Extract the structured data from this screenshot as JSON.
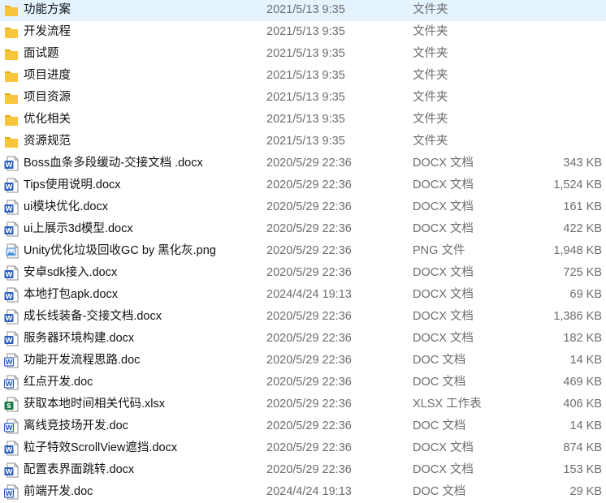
{
  "files": [
    {
      "name": "功能方案",
      "date": "2021/5/13 9:35",
      "type": "文件夹",
      "size": "",
      "icon": "folder-icon"
    },
    {
      "name": "开发流程",
      "date": "2021/5/13 9:35",
      "type": "文件夹",
      "size": "",
      "icon": "folder-icon"
    },
    {
      "name": "面试题",
      "date": "2021/5/13 9:35",
      "type": "文件夹",
      "size": "",
      "icon": "folder-icon"
    },
    {
      "name": "项目进度",
      "date": "2021/5/13 9:35",
      "type": "文件夹",
      "size": "",
      "icon": "folder-icon"
    },
    {
      "name": "项目资源",
      "date": "2021/5/13 9:35",
      "type": "文件夹",
      "size": "",
      "icon": "folder-icon"
    },
    {
      "name": "优化相关",
      "date": "2021/5/13 9:35",
      "type": "文件夹",
      "size": "",
      "icon": "folder-icon"
    },
    {
      "name": "资源规范",
      "date": "2021/5/13 9:35",
      "type": "文件夹",
      "size": "",
      "icon": "folder-icon"
    },
    {
      "name": "Boss血条多段缓动-交接文档 .docx",
      "date": "2020/5/29 22:36",
      "type": "DOCX 文档",
      "size": "343 KB",
      "icon": "word-docx-icon"
    },
    {
      "name": "Tips使用说明.docx",
      "date": "2020/5/29 22:36",
      "type": "DOCX 文档",
      "size": "1,524 KB",
      "icon": "word-docx-icon"
    },
    {
      "name": "ui模块优化.docx",
      "date": "2020/5/29 22:36",
      "type": "DOCX 文档",
      "size": "161 KB",
      "icon": "word-docx-icon"
    },
    {
      "name": "ui上展示3d模型.docx",
      "date": "2020/5/29 22:36",
      "type": "DOCX 文档",
      "size": "422 KB",
      "icon": "word-docx-icon"
    },
    {
      "name": "Unity优化垃圾回收GC by 黑化灰.png",
      "date": "2020/5/29 22:36",
      "type": "PNG 文件",
      "size": "1,948 KB",
      "icon": "png-image-icon"
    },
    {
      "name": "安卓sdk接入.docx",
      "date": "2020/5/29 22:36",
      "type": "DOCX 文档",
      "size": "725 KB",
      "icon": "word-docx-icon"
    },
    {
      "name": "本地打包apk.docx",
      "date": "2024/4/24 19:13",
      "type": "DOCX 文档",
      "size": "69 KB",
      "icon": "word-docx-icon"
    },
    {
      "name": "成长线装备-交接文档.docx",
      "date": "2020/5/29 22:36",
      "type": "DOCX 文档",
      "size": "1,386 KB",
      "icon": "word-docx-icon"
    },
    {
      "name": "服务器环境构建.docx",
      "date": "2020/5/29 22:36",
      "type": "DOCX 文档",
      "size": "182 KB",
      "icon": "word-docx-icon"
    },
    {
      "name": "功能开发流程思路.doc",
      "date": "2020/5/29 22:36",
      "type": "DOC 文档",
      "size": "14 KB",
      "icon": "word-doc-icon"
    },
    {
      "name": "红点开发.doc",
      "date": "2020/5/29 22:36",
      "type": "DOC 文档",
      "size": "469 KB",
      "icon": "word-doc-icon"
    },
    {
      "name": "获取本地时间相关代码.xlsx",
      "date": "2020/5/29 22:36",
      "type": "XLSX 工作表",
      "size": "406 KB",
      "icon": "excel-xlsx-icon"
    },
    {
      "name": "离线竞技场开发.doc",
      "date": "2020/5/29 22:36",
      "type": "DOC 文档",
      "size": "14 KB",
      "icon": "word-doc-icon"
    },
    {
      "name": "粒子特效ScrollView遮挡.docx",
      "date": "2020/5/29 22:36",
      "type": "DOCX 文档",
      "size": "874 KB",
      "icon": "word-docx-icon"
    },
    {
      "name": "配置表界面跳转.docx",
      "date": "2020/5/29 22:36",
      "type": "DOCX 文档",
      "size": "153 KB",
      "icon": "word-docx-icon"
    },
    {
      "name": "前端开发.doc",
      "date": "2024/4/24 19:13",
      "type": "DOC 文档",
      "size": "29 KB",
      "icon": "word-doc-icon"
    }
  ],
  "colors": {
    "folder": "#f8c63d",
    "word": "#2b5fbf",
    "excel": "#1f7a45",
    "png": "#3a88d8"
  }
}
